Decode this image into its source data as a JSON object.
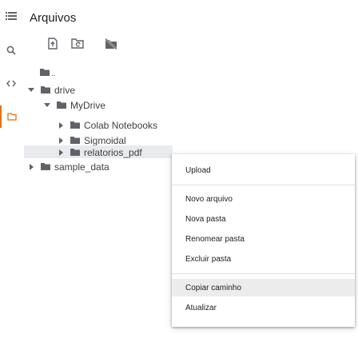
{
  "panel": {
    "title": "Arquivos"
  },
  "rail": {
    "icons": [
      "menu-icon",
      "search-icon",
      "code-icon",
      "folder-icon"
    ]
  },
  "toolbar": {
    "icons": [
      "upload-file-icon",
      "refresh-folder-icon",
      "hide-drive-icon"
    ]
  },
  "tree": {
    "parent_label": "..",
    "drive_label": "drive",
    "mydrive_label": "MyDrive",
    "colab_label": "Colab Notebooks",
    "sigmoidal_label": "Sigmoidal",
    "relatorios_label": "relatorios_pdf",
    "sample_label": "sample_data"
  },
  "menu": {
    "upload": "Upload",
    "novo_arquivo": "Novo arquivo",
    "nova_pasta": "Nova pasta",
    "renomear": "Renomear pasta",
    "excluir": "Excluir pasta",
    "copiar": "Copiar caminho",
    "atualizar": "Atualizar"
  },
  "colors": {
    "folder": "#5f6368",
    "active_accent": "#e8710a",
    "highlight": "#ececec"
  }
}
